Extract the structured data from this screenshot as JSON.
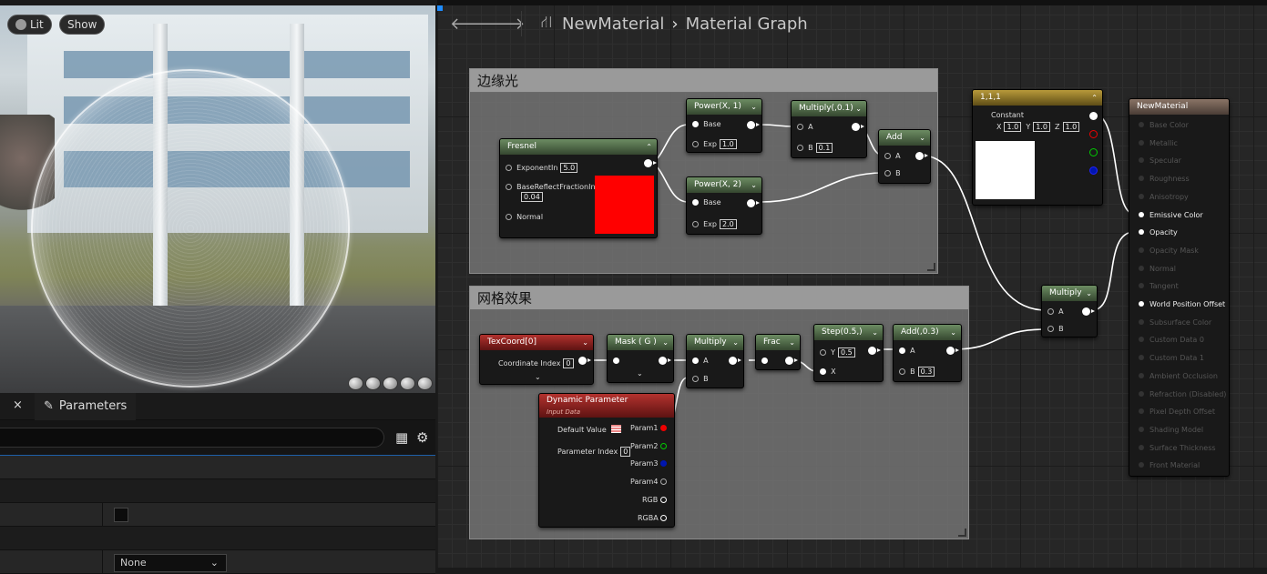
{
  "viewport": {
    "lit_label": "Lit",
    "show_label": "Show"
  },
  "parameters": {
    "close_glyph": "×",
    "tab_label": "Parameters",
    "dropdown_value": "None"
  },
  "graph": {
    "breadcrumb_root": "NewMaterial",
    "breadcrumb_current": "Material Graph",
    "comments": {
      "rim": "边缘光",
      "grid": "网格效果"
    },
    "nodes": {
      "fresnel": {
        "title": "Fresnel",
        "exponent_label": "ExponentIn",
        "exponent": "5.0",
        "base_label": "BaseReflectFractionIn",
        "base": "0.04",
        "normal_label": "Normal"
      },
      "power1": {
        "title": "Power(X, 1)",
        "base": "Base",
        "exp_label": "Exp",
        "exp": "1.0"
      },
      "power2": {
        "title": "Power(X, 2)",
        "base": "Base",
        "exp_label": "Exp",
        "exp": "2.0"
      },
      "mult01": {
        "title": "Multiply(,0.1)",
        "a": "A",
        "b_label": "B",
        "b": "0.1"
      },
      "add": {
        "title": "Add",
        "a": "A",
        "b": "B"
      },
      "const3": {
        "title": "1,1,1",
        "label": "Constant",
        "x_label": "X",
        "x": "1.0",
        "y_label": "Y",
        "y": "1.0",
        "z_label": "Z",
        "z": "1.0"
      },
      "mult_main": {
        "title": "Multiply",
        "a": "A",
        "b": "B"
      },
      "texcoord": {
        "title": "TexCoord[0]",
        "index_label": "Coordinate Index",
        "index": "0"
      },
      "mask": {
        "title": "Mask ( G )"
      },
      "mult_grid": {
        "title": "Multiply",
        "a": "A",
        "b": "B"
      },
      "frac": {
        "title": "Frac"
      },
      "step": {
        "title": "Step(0.5,)",
        "y_label": "Y",
        "y": "0.5",
        "x": "X"
      },
      "add03": {
        "title": "Add(,0.3)",
        "a": "A",
        "b_label": "B",
        "b": "0.3"
      },
      "dynparam": {
        "title": "Dynamic Parameter",
        "subtitle": "Input Data",
        "default_label": "Default Value",
        "index_label": "Parameter Index",
        "index": "0",
        "p1": "Param1",
        "p2": "Param2",
        "p3": "Param3",
        "p4": "Param4",
        "rgb": "RGB",
        "rgba": "RGBA"
      }
    },
    "material": {
      "title": "NewMaterial",
      "pins": [
        {
          "label": "Base Color",
          "active": false
        },
        {
          "label": "Metallic",
          "active": false
        },
        {
          "label": "Specular",
          "active": false
        },
        {
          "label": "Roughness",
          "active": false
        },
        {
          "label": "Anisotropy",
          "active": false
        },
        {
          "label": "Emissive Color",
          "active": true
        },
        {
          "label": "Opacity",
          "active": true
        },
        {
          "label": "Opacity Mask",
          "active": false
        },
        {
          "label": "Normal",
          "active": false
        },
        {
          "label": "Tangent",
          "active": false
        },
        {
          "label": "World Position Offset",
          "active": true
        },
        {
          "label": "Subsurface Color",
          "active": false
        },
        {
          "label": "Custom Data 0",
          "active": false
        },
        {
          "label": "Custom Data 1",
          "active": false
        },
        {
          "label": "Ambient Occlusion",
          "active": false
        },
        {
          "label": "Refraction (Disabled)",
          "active": false
        },
        {
          "label": "Pixel Depth Offset",
          "active": false
        },
        {
          "label": "Shading Model",
          "active": false
        },
        {
          "label": "Surface Thickness",
          "active": false
        },
        {
          "label": "Front Material",
          "active": false
        }
      ]
    },
    "colors": {
      "fresnel_preview": "#ff0000",
      "constant_preview": "#ffffff",
      "accent": "#1e60a8"
    }
  }
}
